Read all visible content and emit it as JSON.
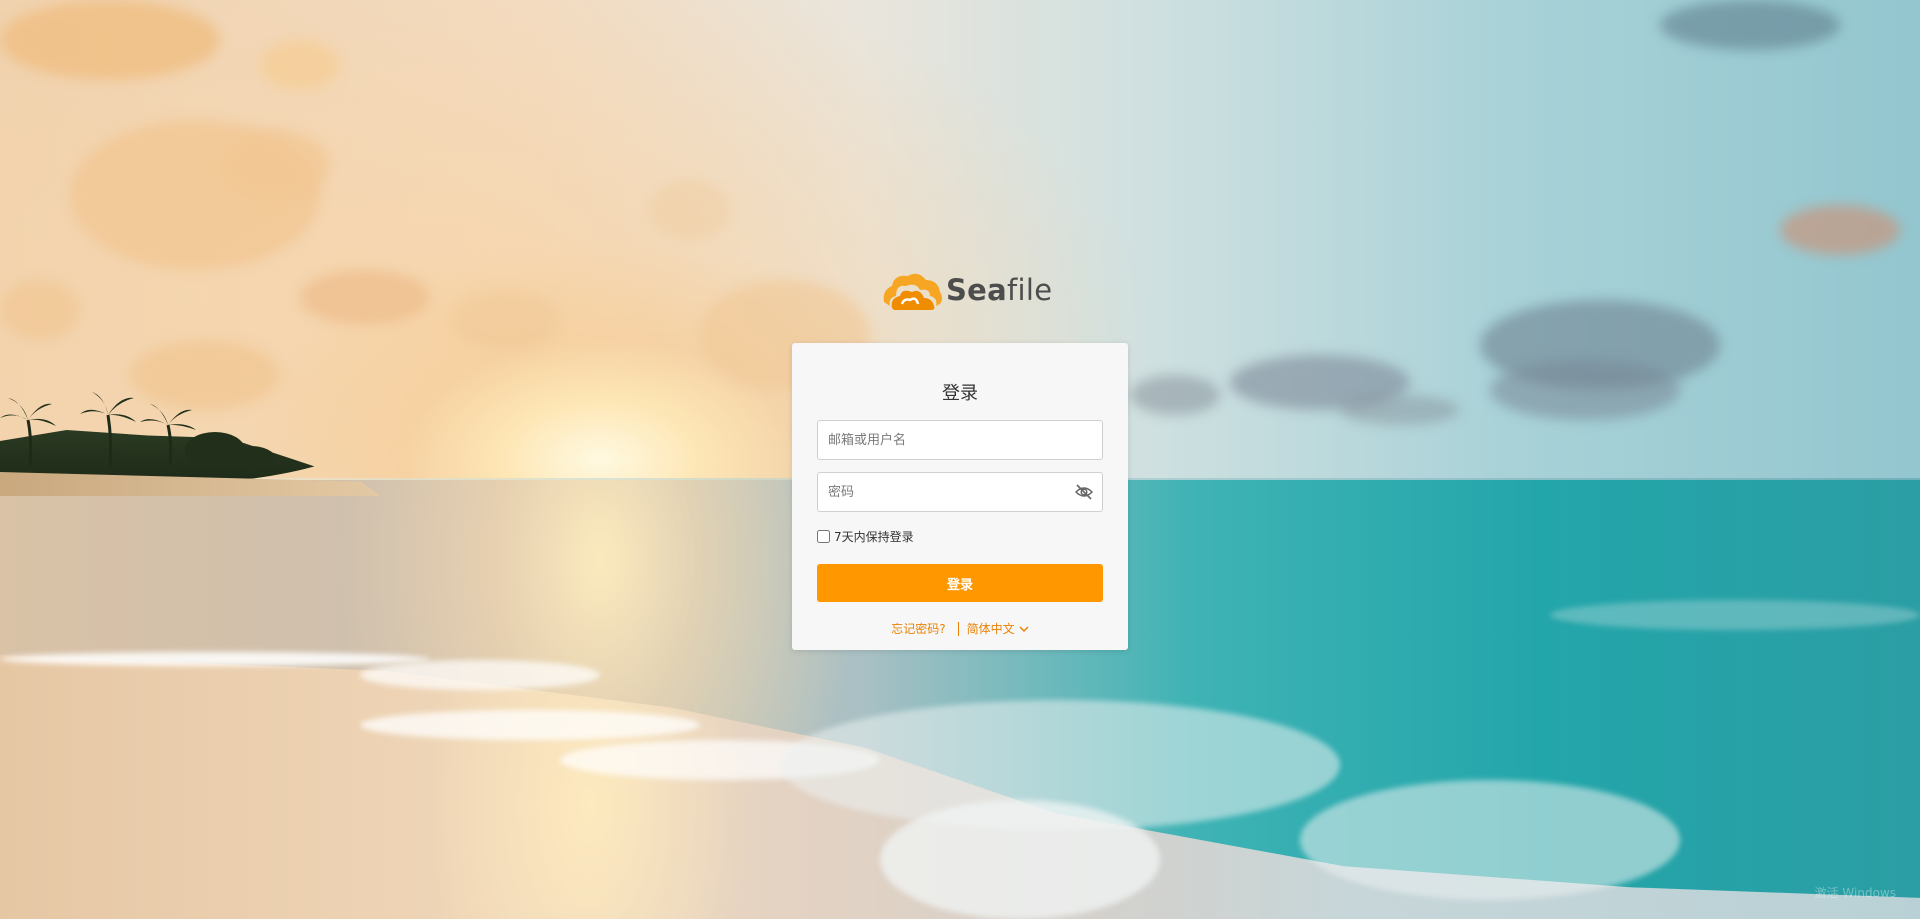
{
  "brand": {
    "name_bold": "Sea",
    "name_rest": "file",
    "logo_icon": "seafile-logo-icon",
    "accent_color": "#ff9800"
  },
  "login": {
    "title": "登录",
    "username_placeholder": "邮箱或用户名",
    "username_value": "",
    "password_placeholder": "密码",
    "password_value": "",
    "password_toggle_icon": "eye-slash-icon",
    "remember_label": "7天内保持登录",
    "remember_checked": false,
    "submit_label": "登录",
    "forgot_label": "忘记密码?",
    "language_label": "简体中文",
    "language_icon": "chevron-down-icon"
  },
  "footer": {
    "watermark_text": "激活 Windows"
  }
}
